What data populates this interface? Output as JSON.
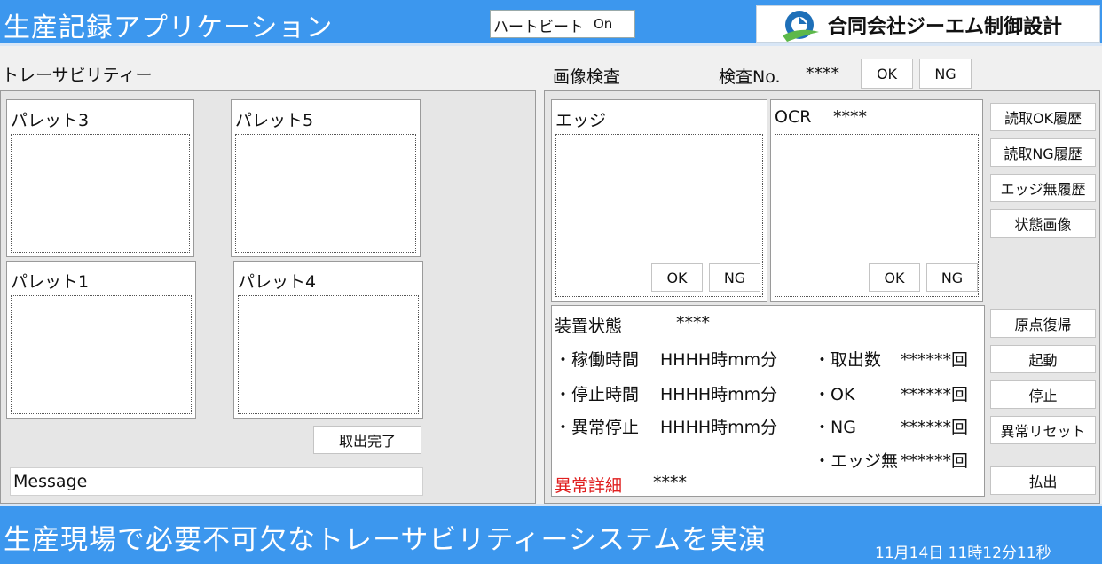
{
  "header": {
    "app_title": "生産記録アプリケーション",
    "heartbeat_label": "ハートビート",
    "heartbeat_value": "On",
    "company_name": "合同会社ジーエム制御設計"
  },
  "traceability": {
    "label": "トレーサビリティー",
    "pallets": [
      {
        "name": "パレット3"
      },
      {
        "name": "パレット5"
      },
      {
        "name": "パレット1"
      },
      {
        "name": "パレット4"
      }
    ],
    "take_out_done_label": "取出完了",
    "message_value": "Message"
  },
  "inspection": {
    "label": "画像検査",
    "inspection_no_label": "検査No.",
    "inspection_no_value": "****",
    "ok_label": "OK",
    "ng_label": "NG",
    "edge": {
      "title": "エッジ",
      "ok_label": "OK",
      "ng_label": "NG"
    },
    "ocr": {
      "title": "OCR",
      "value": "****",
      "ok_label": "OK",
      "ng_label": "NG"
    }
  },
  "side_buttons": {
    "read_ok_history": "読取OK履歴",
    "read_ng_history": "読取NG履歴",
    "no_edge_history": "エッジ無履歴",
    "status_image": "状態画像",
    "origin_return": "原点復帰",
    "start": "起動",
    "stop": "停止",
    "error_reset": "異常リセット",
    "discharge": "払出"
  },
  "device_status": {
    "title": "装置状態",
    "value": "****",
    "rows_left": [
      {
        "label": "・稼働時間",
        "value": "HHHH時mm分"
      },
      {
        "label": "・停止時間",
        "value": "HHHH時mm分"
      },
      {
        "label": "・異常停止",
        "value": "HHHH時mm分"
      }
    ],
    "rows_right": [
      {
        "label": "・取出数",
        "value": "******回"
      },
      {
        "label": "・OK",
        "value": "******回"
      },
      {
        "label": "・NG",
        "value": "******回"
      },
      {
        "label": "・エッジ無",
        "value": "******回"
      }
    ],
    "error_detail_label": "異常詳細",
    "error_detail_value": "****"
  },
  "footer": {
    "slogan": "生産現場で必要不可欠なトレーサビリティーシステムを実演",
    "datetime": "11月14日 11時12分11秒"
  },
  "colors": {
    "header_blue": "#3c97ee",
    "error_red": "#e02020",
    "logo_blue": "#1e6fb8",
    "logo_green": "#5db84a"
  }
}
